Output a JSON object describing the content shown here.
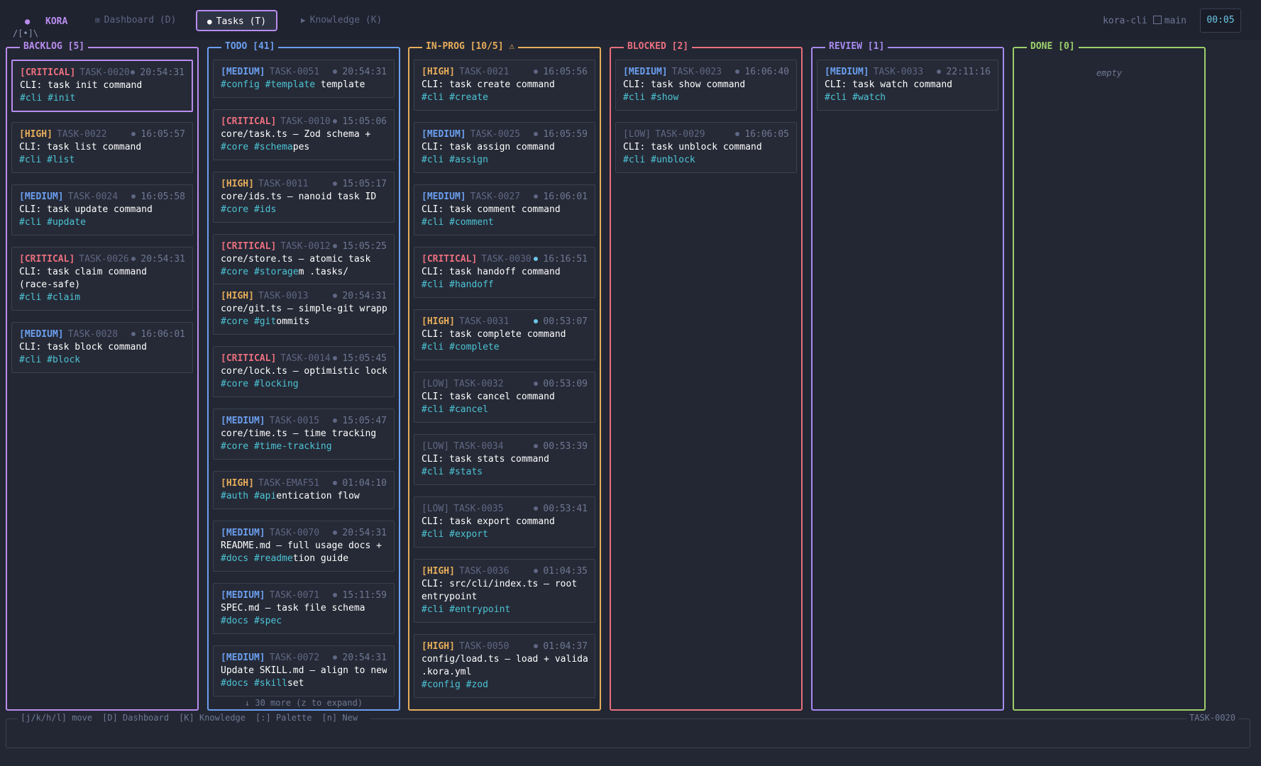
{
  "app": {
    "name": "KORA",
    "ascii": "/[•]\\",
    "repo": "kora-cli",
    "branch": "main",
    "clock": "00:05"
  },
  "tabs": [
    {
      "label": "Dashboard (D)",
      "icon": "grid-icon"
    },
    {
      "label": "Tasks (T)",
      "icon": "dot-icon"
    },
    {
      "label": "Knowledge (K)",
      "icon": "triangle-icon"
    }
  ],
  "columns": {
    "backlog": {
      "title": "BACKLOG [5]",
      "cards": [
        {
          "priority": "[CRITICAL]",
          "id": "TASK-0020",
          "time": "20:54:31",
          "title": "CLI: task init command",
          "tags": "#cli #init"
        },
        {
          "priority": "[HIGH]",
          "id": "TASK-0022",
          "time": "16:05:57",
          "title": "CLI: task list command",
          "tags": "#cli #list"
        },
        {
          "priority": "[MEDIUM]",
          "id": "TASK-0024",
          "time": "16:05:58",
          "title": "CLI: task update command",
          "tags": "#cli #update"
        },
        {
          "priority": "[CRITICAL]",
          "id": "TASK-0026",
          "time": "20:54:31",
          "title": "CLI: task claim command",
          "title2": "(race-safe)",
          "tags": "#cli #claim"
        },
        {
          "priority": "[MEDIUM]",
          "id": "TASK-0028",
          "time": "16:06:01",
          "title": "CLI: task block command",
          "tags": "#cli #block"
        }
      ]
    },
    "todo": {
      "title": "TODO [41]",
      "more": "↓ 30 more (z to expand)",
      "cards": [
        {
          "priority": "[MEDIUM]",
          "id": "TASK-0051",
          "time": "20:54:31",
          "tags": "#config #template",
          "title": "template"
        },
        {
          "priority": "[CRITICAL]",
          "id": "TASK-0010",
          "time": "15:05:06",
          "title": "core/task.ts — Zod schema +",
          "tags": "#core #schema",
          "title_tail": "pes"
        },
        {
          "priority": "[HIGH]",
          "id": "TASK-0011",
          "time": "15:05:17",
          "title": "core/ids.ts — nanoid task ID",
          "tags": "#core #ids"
        },
        {
          "priority": "[CRITICAL]",
          "id": "TASK-0012",
          "time": "15:05:25",
          "title": "core/store.ts — atomic task",
          "tags": "#core #storage",
          "title_tail": "m .tasks/"
        },
        {
          "priority": "[HIGH]",
          "id": "TASK-0013",
          "time": "20:54:31",
          "title": "core/git.ts — simple-git wrapper",
          "tags": "#core #git",
          "title_tail": "ommits"
        },
        {
          "priority": "[CRITICAL]",
          "id": "TASK-0014",
          "time": "15:05:45",
          "title": "core/lock.ts — optimistic locking",
          "tags": "#core #locking"
        },
        {
          "priority": "[MEDIUM]",
          "id": "TASK-0015",
          "time": "15:05:47",
          "title": "core/time.ts — time tracking",
          "tags": "#core #time-tracking"
        },
        {
          "priority": "[HIGH]",
          "id": "TASK-EMAF51",
          "time": "01:04:10",
          "tags": "#auth #api",
          "title_tail": "entication flow"
        },
        {
          "priority": "[MEDIUM]",
          "id": "TASK-0070",
          "time": "20:54:31",
          "title": "README.md — full usage docs +",
          "tags": "#docs #readme",
          "title_tail": "tion guide"
        },
        {
          "priority": "[MEDIUM]",
          "id": "TASK-0071",
          "time": "15:11:59",
          "title": "SPEC.md — task file schema",
          "tags": "#docs #spec"
        },
        {
          "priority": "[MEDIUM]",
          "id": "TASK-0072",
          "time": "20:54:31",
          "title": "Update SKILL.md — align to new",
          "tags": "#docs #skill",
          "title_tail": "set"
        }
      ]
    },
    "inprog": {
      "title": "IN-PROG [10/5] ⚠",
      "cards": [
        {
          "priority": "[HIGH]",
          "id": "TASK-0021",
          "time": "16:05:56",
          "title": "CLI: task create command",
          "tags": "#cli #create"
        },
        {
          "priority": "[MEDIUM]",
          "id": "TASK-0025",
          "time": "16:05:59",
          "title": "CLI: task assign command",
          "tags": "#cli #assign"
        },
        {
          "priority": "[MEDIUM]",
          "id": "TASK-0027",
          "time": "16:06:01",
          "title": "CLI: task comment command",
          "tags": "#cli #comment"
        },
        {
          "priority": "[CRITICAL]",
          "id": "TASK-0030",
          "time": "16:16:51",
          "title": "CLI: task handoff command",
          "tags": "#cli #handoff",
          "live": true
        },
        {
          "priority": "[HIGH]",
          "id": "TASK-0031",
          "time": "00:53:07",
          "title": "CLI: task complete command",
          "tags": "#cli #complete",
          "live": true
        },
        {
          "priority": "[LOW]",
          "id": "TASK-0032",
          "time": "00:53:09",
          "title": "CLI: task cancel command",
          "tags": "#cli #cancel"
        },
        {
          "priority": "[LOW]",
          "id": "TASK-0034",
          "time": "00:53:39",
          "title": "CLI: task stats command",
          "tags": "#cli #stats"
        },
        {
          "priority": "[LOW]",
          "id": "TASK-0035",
          "time": "00:53:41",
          "title": "CLI: task export command",
          "tags": "#cli #export"
        },
        {
          "priority": "[HIGH]",
          "id": "TASK-0036",
          "time": "01:04:35",
          "title": "CLI: src/cli/index.ts — root",
          "title2": "entrypoint",
          "tags": "#cli #entrypoint"
        },
        {
          "priority": "[HIGH]",
          "id": "TASK-0050",
          "time": "01:04:37",
          "title": "config/load.ts — load + validate",
          "title2": ".kora.yml",
          "tags": "#config #zod"
        }
      ]
    },
    "blocked": {
      "title": "BLOCKED [2]",
      "cards": [
        {
          "priority": "[MEDIUM]",
          "id": "TASK-0023",
          "time": "16:06:40",
          "title": "CLI: task show command",
          "tags": "#cli #show"
        },
        {
          "priority": "[LOW]",
          "id": "TASK-0029",
          "time": "16:06:05",
          "title": "CLI: task unblock command",
          "tags": "#cli #unblock"
        }
      ]
    },
    "review": {
      "title": "REVIEW [1]",
      "cards": [
        {
          "priority": "[MEDIUM]",
          "id": "TASK-0033",
          "time": "22:11:16",
          "title": "CLI: task watch command",
          "tags": "#cli #watch"
        }
      ]
    },
    "done": {
      "title": "DONE [0]",
      "empty": "empty"
    }
  },
  "footer": {
    "hints": [
      "[j/k/h/l] move",
      "[D] Dashboard",
      "[K] Knowledge",
      "[:] Palette",
      "[n] New"
    ],
    "selected": "TASK-0020"
  }
}
